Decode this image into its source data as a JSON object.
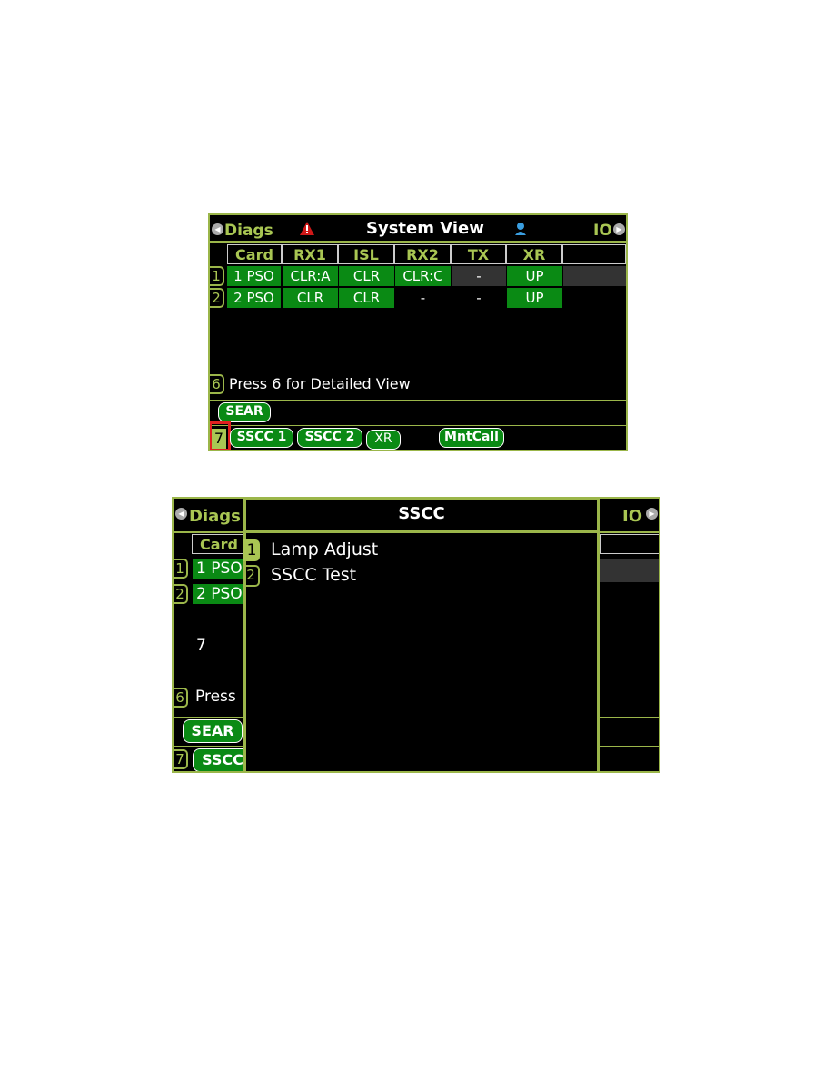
{
  "screen1": {
    "left_nav": "Diags",
    "title": "System View",
    "right_nav": "IO",
    "columns": [
      "Card",
      "RX1",
      "ISL",
      "RX2",
      "TX",
      "XR",
      ""
    ],
    "rows": [
      {
        "key": "1",
        "cells": [
          "1 PSO",
          "CLR:A",
          "CLR",
          "CLR:C",
          "-",
          "UP",
          ""
        ]
      },
      {
        "key": "2",
        "cells": [
          "2 PSO",
          "CLR",
          "CLR",
          "-",
          "-",
          "UP",
          ""
        ]
      }
    ],
    "hint_key": "6",
    "hint": "Press 6 for Detailed View",
    "sear_button": "SEAR",
    "softkey_key": "7",
    "softkeys": [
      "SSCC 1",
      "SSCC 2",
      "XR",
      "MntCall"
    ],
    "colors": {
      "accent": "#9bb64a",
      "ok": "#0a8a14",
      "highlight": "#e02020"
    }
  },
  "screen2": {
    "left_nav": "Diags",
    "right_nav": "IO",
    "popup_title": "SSCC",
    "bg_card": "Card",
    "bg_rows": [
      {
        "key": "1",
        "label": "1 PSO"
      },
      {
        "key": "2",
        "label": "2 PSO"
      }
    ],
    "bg_number": "7",
    "bg_hint_key": "6",
    "bg_hint": "Press",
    "bg_sear": "SEAR",
    "bg_softkey_key": "7",
    "bg_softkey": "SSCC",
    "menu": [
      {
        "key": "1",
        "label": "Lamp Adjust"
      },
      {
        "key": "2",
        "label": "SSCC Test"
      }
    ]
  }
}
